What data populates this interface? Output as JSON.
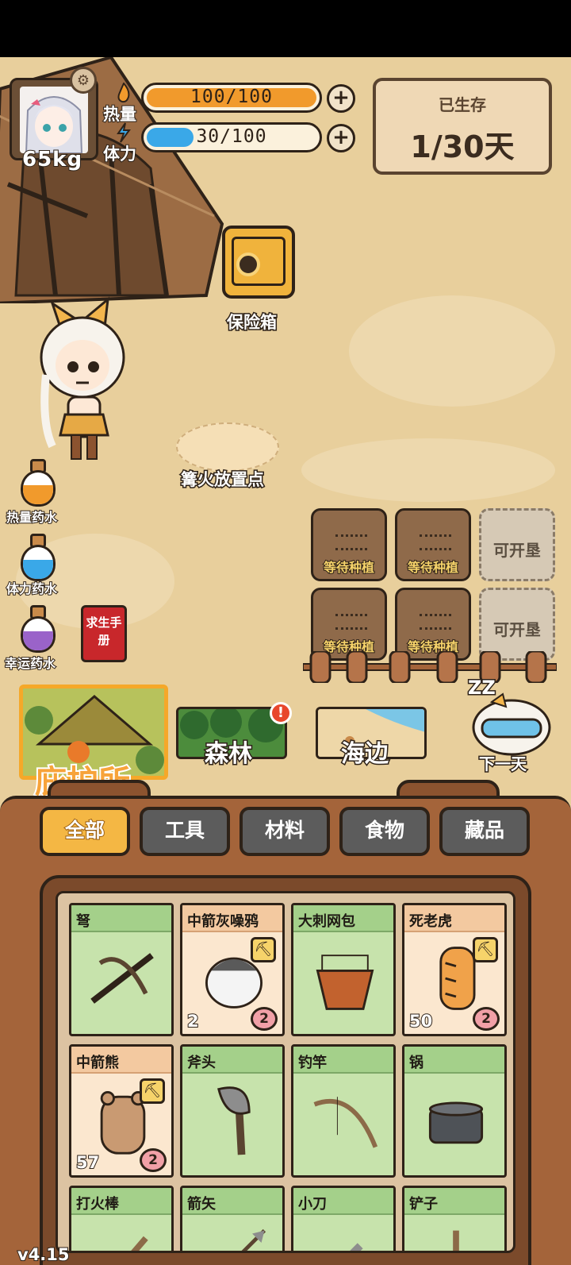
{
  "hud": {
    "weight": "65kg",
    "calories_label": "热量",
    "calories_value": "100/100",
    "calories_ratio": 1.0,
    "stamina_label": "体力",
    "stamina_value": "30/100",
    "stamina_ratio": 0.3,
    "survived_title": "已生存",
    "survived_days": "1/30天"
  },
  "world": {
    "safe_label": "保险箱",
    "campfire_label": "篝火放置点",
    "potions": [
      {
        "label": "热量药水",
        "color": "#f19a2c"
      },
      {
        "label": "体力药水",
        "color": "#3aa8e8"
      },
      {
        "label": "幸运药水",
        "color": "#9a63c9"
      }
    ],
    "manual_label": "求生手册",
    "plots": [
      {
        "label": "等待种植",
        "locked": false
      },
      {
        "label": "等待种植",
        "locked": false
      },
      {
        "label": "可开垦",
        "locked": true
      },
      {
        "label": "等待种植",
        "locked": false
      },
      {
        "label": "等待种植",
        "locked": false
      },
      {
        "label": "可开垦",
        "locked": true
      }
    ]
  },
  "locations": {
    "shelter": "庇护所",
    "forest": "森林",
    "forest_badge": "!",
    "beach": "海边",
    "next_day": "下一天",
    "sleep_icon": "ZZ"
  },
  "inventory": {
    "tabs": [
      "全部",
      "工具",
      "材料",
      "食物",
      "藏品"
    ],
    "active_tab": "全部",
    "items": [
      {
        "name": "弩",
        "icon": "crossbow-icon",
        "warm": false,
        "count": "",
        "pig": "",
        "shovel": false
      },
      {
        "name": "中箭灰噪鸦",
        "icon": "crow-icon",
        "warm": true,
        "count": "2",
        "pig": "2",
        "shovel": true
      },
      {
        "name": "大刺网包",
        "icon": "net-bag-icon",
        "warm": false,
        "count": "",
        "pig": "",
        "shovel": false
      },
      {
        "name": "死老虎",
        "icon": "tiger-icon",
        "warm": true,
        "count": "50",
        "pig": "2",
        "shovel": true
      },
      {
        "name": "中箭熊",
        "icon": "bear-icon",
        "warm": true,
        "count": "57",
        "pig": "2",
        "shovel": true
      },
      {
        "name": "斧头",
        "icon": "axe-icon",
        "warm": false,
        "count": "",
        "pig": "",
        "shovel": false
      },
      {
        "name": "钓竿",
        "icon": "fishing-rod-icon",
        "warm": false,
        "count": "",
        "pig": "",
        "shovel": false
      },
      {
        "name": "锅",
        "icon": "pot-icon",
        "warm": false,
        "count": "",
        "pig": "",
        "shovel": false
      },
      {
        "name": "打火棒",
        "icon": "fire-stick-icon",
        "warm": false,
        "count": "",
        "pig": "",
        "shovel": false
      },
      {
        "name": "箭矢",
        "icon": "arrow-icon",
        "warm": false,
        "count": "",
        "pig": "",
        "shovel": false
      },
      {
        "name": "小刀",
        "icon": "knife-icon",
        "warm": false,
        "count": "",
        "pig": "",
        "shovel": false
      },
      {
        "name": "铲子",
        "icon": "shovel-icon",
        "warm": false,
        "count": "",
        "pig": "",
        "shovel": false
      }
    ]
  },
  "version": "v4.15"
}
